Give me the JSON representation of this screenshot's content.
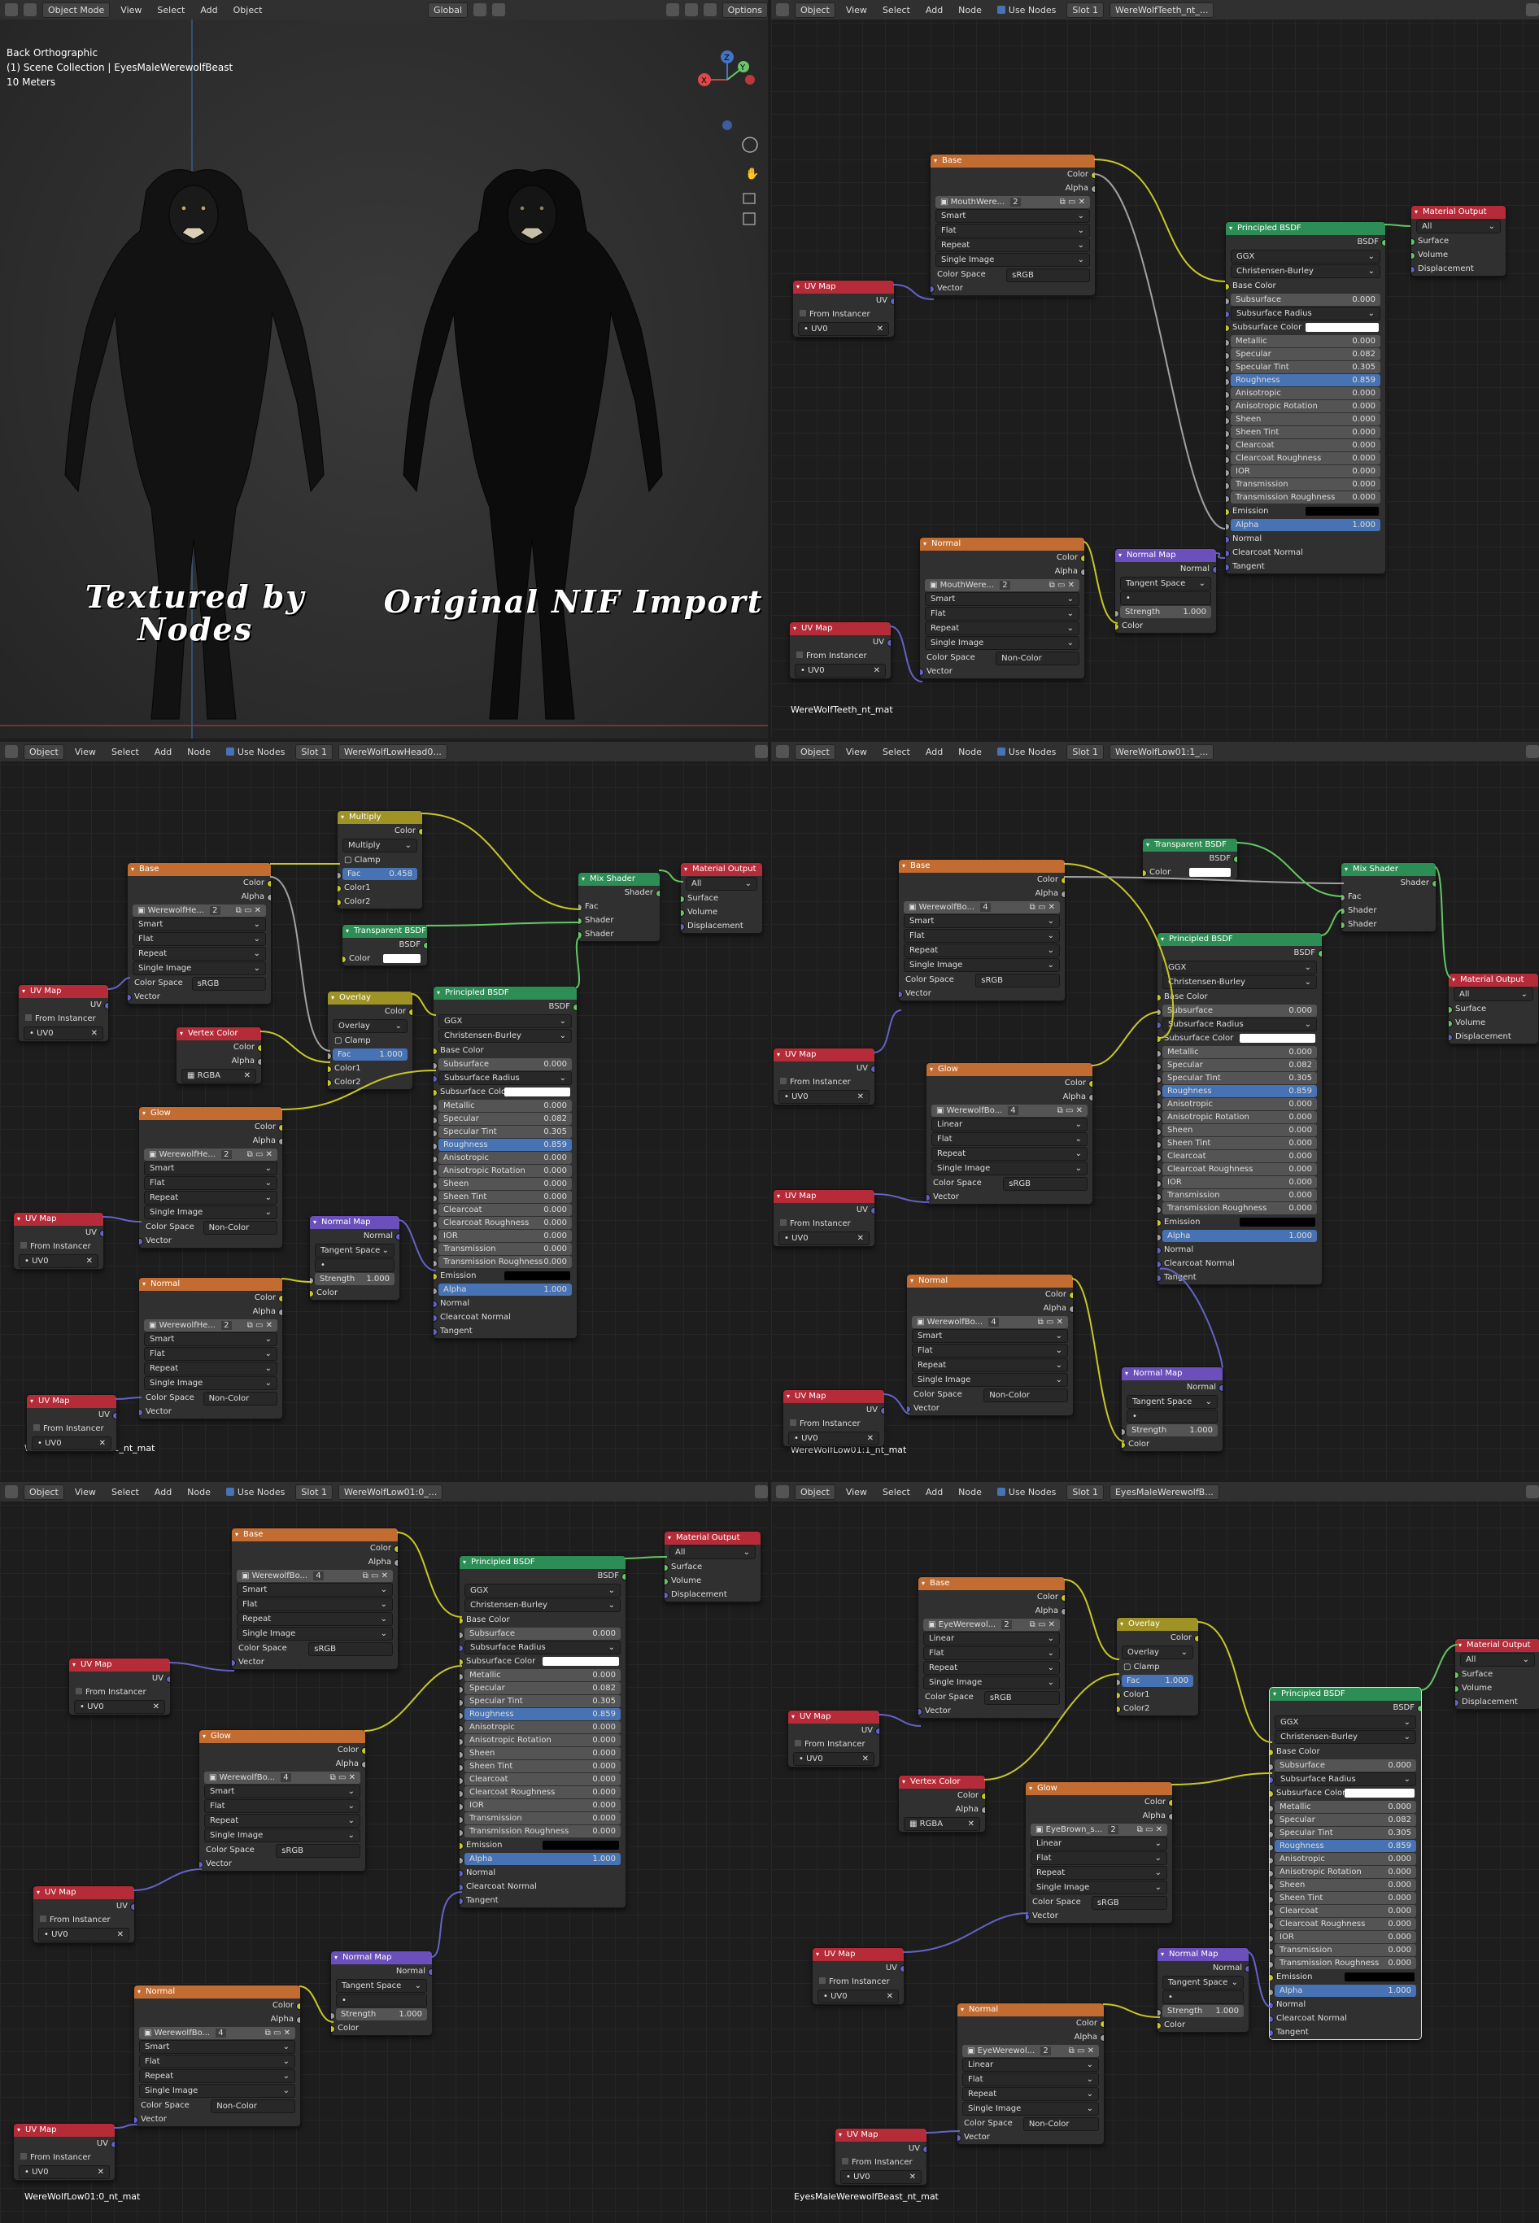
{
  "viewport": {
    "header": {
      "mode": "Object Mode",
      "menus": [
        "View",
        "Select",
        "Add",
        "Object"
      ],
      "transform": "Global",
      "options": "Options"
    },
    "info": {
      "view": "Back Orthographic",
      "collection": "(1) Scene Collection | EyesMaleWerewolfBeast",
      "scale": "10 Meters"
    },
    "caption_left": "Textured by Nodes",
    "caption_right": "Original NIF Import",
    "gizmo": {
      "x": "X",
      "y": "Y",
      "z": "Z"
    }
  },
  "editors": [
    {
      "id": "teeth",
      "object": "Object",
      "menus": [
        "View",
        "Select",
        "Add",
        "Node"
      ],
      "use_nodes": "Use Nodes",
      "slot": "Slot 1",
      "material": "WereWolfTeeth_nt_...",
      "label": "WereWolfTeeth_nt_mat"
    },
    {
      "id": "head",
      "object": "Object",
      "menus": [
        "View",
        "Select",
        "Add",
        "Node"
      ],
      "use_nodes": "Use Nodes",
      "slot": "Slot 1",
      "material": "WereWolfLowHead0...",
      "label": "WereWolfLowHead01_nt_mat"
    },
    {
      "id": "low11",
      "object": "Object",
      "menus": [
        "View",
        "Select",
        "Add",
        "Node"
      ],
      "use_nodes": "Use Nodes",
      "slot": "Slot 1",
      "material": "WereWolfLow01:1_...",
      "label": "WereWolfLow01:1_nt_mat"
    },
    {
      "id": "low10",
      "object": "Object",
      "menus": [
        "View",
        "Select",
        "Add",
        "Node"
      ],
      "use_nodes": "Use Nodes",
      "slot": "Slot 1",
      "material": "WereWolfLow01:0_...",
      "label": "WereWolfLow01:0_nt_mat"
    },
    {
      "id": "eyes",
      "object": "Object",
      "menus": [
        "View",
        "Select",
        "Add",
        "Node"
      ],
      "use_nodes": "Use Nodes",
      "slot": "Slot 1",
      "material": "EyesMaleWerewolfB...",
      "label": "EyesMaleWerewolfBeast_nt_mat"
    }
  ],
  "nodes": {
    "image_tex": {
      "color": "Color",
      "alpha": "Alpha",
      "interp_smart": "Smart",
      "interp_linear": "Linear",
      "proj": "Flat",
      "ext": "Repeat",
      "source": "Single Image",
      "cs_label": "Color Space",
      "srgb": "sRGB",
      "noncolor": "Non-Color",
      "vector": "Vector"
    },
    "uv_map": {
      "title": "UV Map",
      "uv": "UV",
      "from_instancer": "From Instancer",
      "uv0": "UV0"
    },
    "bsdf": {
      "title": "Principled BSDF",
      "out": "BSDF",
      "dist": "GGX",
      "sss": "Christensen-Burley",
      "rows": [
        {
          "label": "Base Color",
          "kind": "socket"
        },
        {
          "label": "Subsurface",
          "val": "0.000"
        },
        {
          "label": "Subsurface Radius",
          "kind": "dd"
        },
        {
          "label": "Subsurface Color",
          "kind": "white"
        },
        {
          "label": "Metallic",
          "val": "0.000"
        },
        {
          "label": "Specular",
          "val": "0.082"
        },
        {
          "label": "Specular Tint",
          "val": "0.305"
        },
        {
          "label": "Roughness",
          "val": "0.859",
          "kind": "blue"
        },
        {
          "label": "Anisotropic",
          "val": "0.000"
        },
        {
          "label": "Anisotropic Rotation",
          "val": "0.000"
        },
        {
          "label": "Sheen",
          "val": "0.000"
        },
        {
          "label": "Sheen Tint",
          "val": "0.000"
        },
        {
          "label": "Clearcoat",
          "val": "0.000"
        },
        {
          "label": "Clearcoat Roughness",
          "val": "0.000"
        },
        {
          "label": "IOR",
          "val": "0.000"
        },
        {
          "label": "Transmission",
          "val": "0.000"
        },
        {
          "label": "Transmission Roughness",
          "val": "0.000"
        },
        {
          "label": "Emission",
          "kind": "black"
        },
        {
          "label": "Alpha",
          "val": "1.000",
          "kind": "blue"
        },
        {
          "label": "Normal",
          "kind": "socket"
        },
        {
          "label": "Clearcoat Normal",
          "kind": "socket"
        },
        {
          "label": "Tangent",
          "kind": "socket"
        }
      ]
    },
    "output": {
      "title": "Material Output",
      "target": "All",
      "surface": "Surface",
      "volume": "Volume",
      "displacement": "Displacement"
    },
    "normal_map": {
      "title": "Normal Map",
      "normal": "Normal",
      "space": "Tangent Space",
      "strength": "Strength",
      "strength_val": "1.000",
      "color": "Color"
    },
    "mix": {
      "title": "Mix Shader",
      "shader": "Shader",
      "fac": "Fac"
    },
    "transparent": {
      "title": "Transparent BSDF",
      "bsdf": "BSDF",
      "color": "Color"
    },
    "multiply": {
      "title": "Multiply",
      "mode": "Multiply",
      "clamp": "Clamp",
      "fac": "Fac",
      "fac_val": "0.458",
      "color": "Color",
      "color1": "Color1",
      "color2": "Color2"
    },
    "overlay": {
      "title": "Overlay",
      "mode": "Overlay",
      "clamp": "Clamp",
      "fac": "Fac",
      "fac_val": "1.000"
    },
    "vertex_color": {
      "title": "Vertex Color",
      "color": "Color",
      "alpha": "Alpha",
      "layer": "RGBA"
    },
    "tex_titles": {
      "base": "Base",
      "normal": "Normal",
      "glow": "Glow"
    },
    "images": {
      "teeth_base": "MouthWere...",
      "teeth_norm": "MouthWere...",
      "head": "WerewolfHe...",
      "body": "WerewolfBo...",
      "eye": "EyeWerewol...",
      "brow": "EyeBrown_s...",
      "count2": "2",
      "count4": "4"
    }
  }
}
